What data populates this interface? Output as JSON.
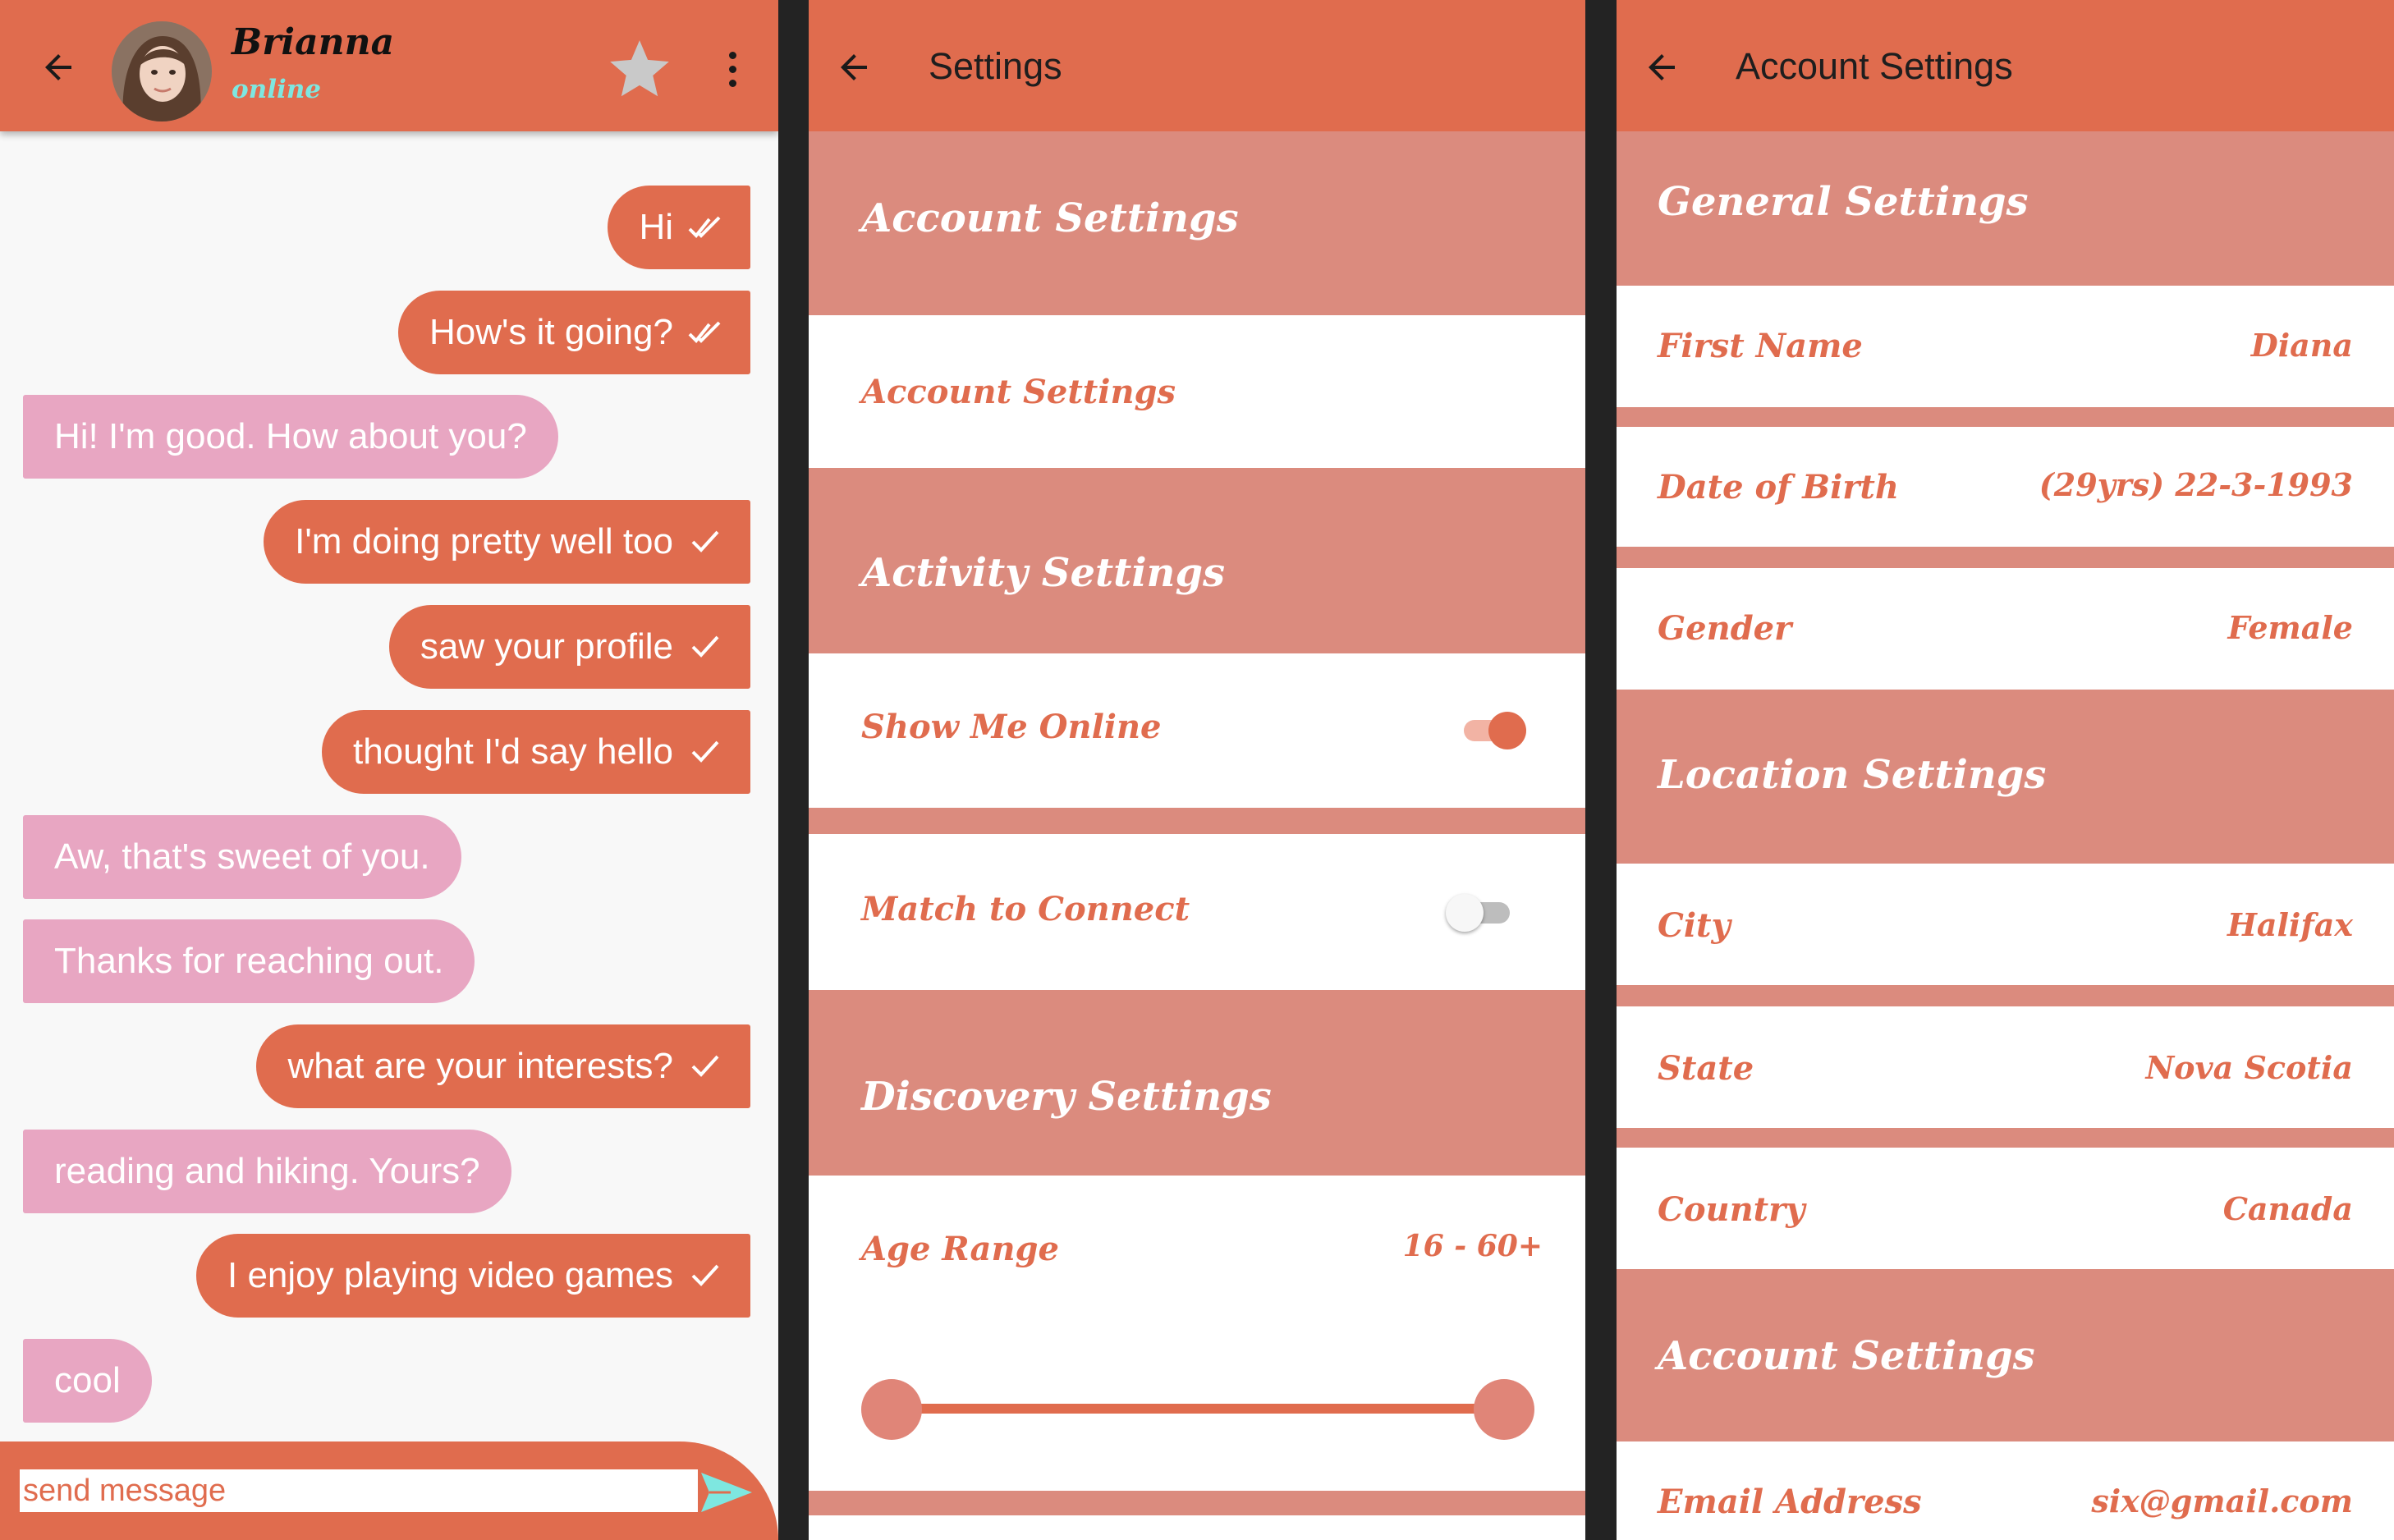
{
  "colors": {
    "primary": "#e06c4e",
    "section": "#db8b7e",
    "incoming_bubble": "#e8a6c2",
    "online": "#7ee7e0"
  },
  "chat": {
    "contact_name": "Brianna",
    "status": "online",
    "icons": [
      "back-arrow-icon",
      "star-icon",
      "more-vert-icon",
      "send-icon"
    ],
    "messages": [
      {
        "text": "Hi",
        "direction": "out",
        "status": "read"
      },
      {
        "text": "How's it going?",
        "direction": "out",
        "status": "read"
      },
      {
        "text": "Hi! I'm good. How about you?",
        "direction": "in"
      },
      {
        "text": "I'm doing pretty well too",
        "direction": "out",
        "status": "sent"
      },
      {
        "text": "saw your profile",
        "direction": "out",
        "status": "sent"
      },
      {
        "text": "thought I'd say hello",
        "direction": "out",
        "status": "sent"
      },
      {
        "text": "Aw, that's sweet of you.",
        "direction": "in"
      },
      {
        "text": "Thanks for reaching out.",
        "direction": "in"
      },
      {
        "text": "what are your interests?",
        "direction": "out",
        "status": "sent"
      },
      {
        "text": "reading and hiking. Yours?",
        "direction": "in"
      },
      {
        "text": "I enjoy playing video games",
        "direction": "out",
        "status": "sent"
      },
      {
        "text": "cool",
        "direction": "in"
      }
    ],
    "composer": {
      "placeholder": "send message",
      "value": ""
    }
  },
  "settings": {
    "title": "Settings",
    "account_section": "Account Settings",
    "account_item": "Account Settings",
    "activity_section": "Activity Settings",
    "show_online": {
      "label": "Show Me Online",
      "on": true
    },
    "match_connect": {
      "label": "Match to Connect",
      "on": false
    },
    "discovery_section": "Discovery Settings",
    "age_range": {
      "label": "Age Range",
      "value": "16 - 60+",
      "min": 16,
      "max": 60
    }
  },
  "account": {
    "title": "Account Settings",
    "general_section": "General Settings",
    "first_name": {
      "label": "First Name",
      "value": "Diana"
    },
    "dob": {
      "label": "Date of Birth",
      "value": "(29yrs) 22-3-1993"
    },
    "gender": {
      "label": "Gender",
      "value": "Female"
    },
    "location_section": "Location Settings",
    "city": {
      "label": "City",
      "value": "Halifax"
    },
    "state": {
      "label": "State",
      "value": "Nova Scotia"
    },
    "country": {
      "label": "Country",
      "value": "Canada"
    },
    "account_section": "Account Settings",
    "email": {
      "label": "Email Address",
      "value": "six@gmail.com"
    }
  }
}
